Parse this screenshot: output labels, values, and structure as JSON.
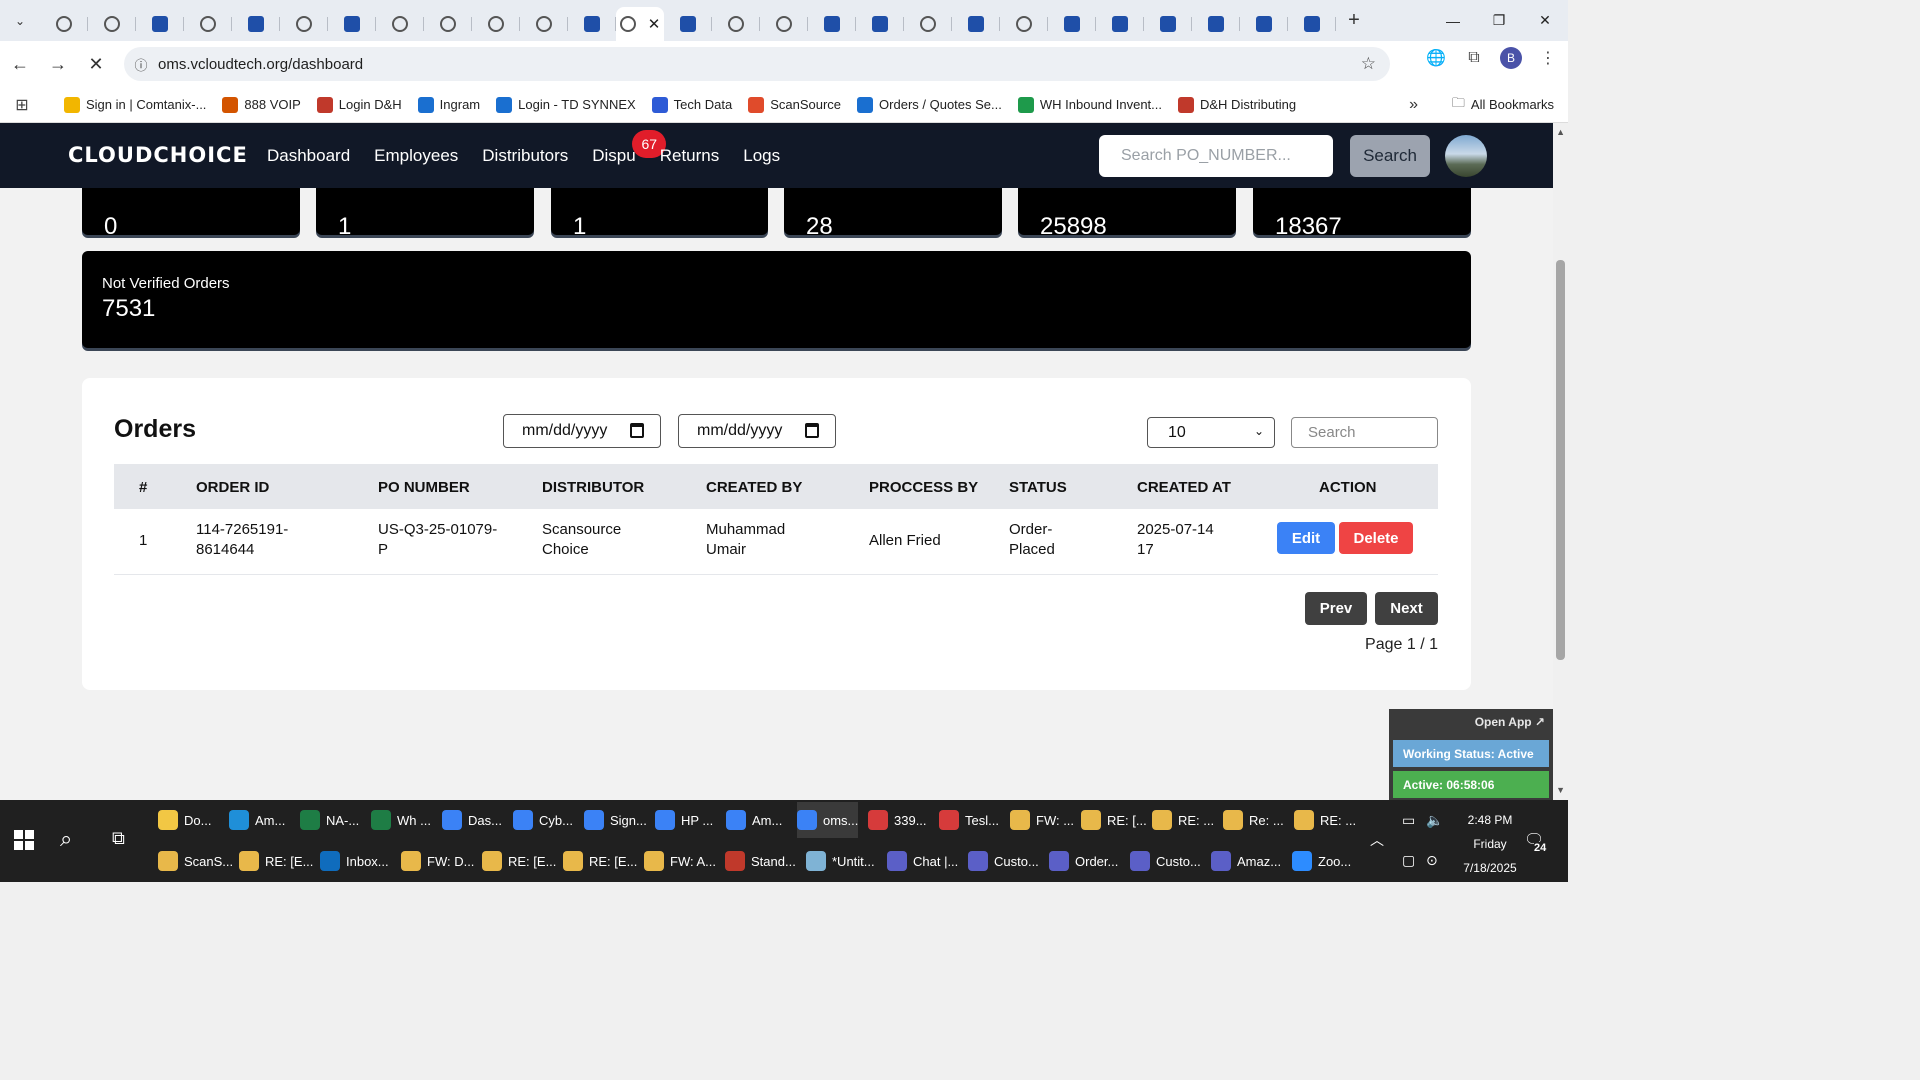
{
  "browser": {
    "url": "oms.vcloudtech.org/dashboard",
    "bookmarks": [
      {
        "label": "Sign in | Comtanix-...",
        "color": "#f2b600"
      },
      {
        "label": "888 VOIP",
        "color": "#d35400"
      },
      {
        "label": "Login D&H",
        "color": "#c0392b"
      },
      {
        "label": "Ingram",
        "color": "#1a6fd0"
      },
      {
        "label": "Login - TD SYNNEX",
        "color": "#1a6fd0"
      },
      {
        "label": "Tech Data",
        "color": "#2e5bd6"
      },
      {
        "label": "ScanSource",
        "color": "#e04b2b"
      },
      {
        "label": "Orders / Quotes Se...",
        "color": "#1a6fd0"
      },
      {
        "label": "WH Inbound Invent...",
        "color": "#1e9a4b"
      },
      {
        "label": "D&H Distributing",
        "color": "#c0392b"
      }
    ],
    "all_bookmarks": "All Bookmarks",
    "profile_initial": "B"
  },
  "navbar": {
    "logo": "CLOUDCHOICE",
    "links": [
      "Dashboard",
      "Employees",
      "Distributors",
      "Dispu",
      "Returns",
      "Logs"
    ],
    "badge": "67",
    "search_placeholder": "Search PO_NUMBER...",
    "search_button": "Search"
  },
  "stats": [
    "0",
    "1",
    "1",
    "28",
    "25898",
    "18367"
  ],
  "not_verified": {
    "label": "Not Verified Orders",
    "value": "7531"
  },
  "orders": {
    "title": "Orders",
    "date_from": "mm/dd/yyyy",
    "date_to": "mm/dd/yyyy",
    "page_size": "10",
    "search_placeholder": "Search",
    "columns": [
      "#",
      "ORDER ID",
      "PO NUMBER",
      "DISTRIBUTOR",
      "CREATED BY",
      "PROCCESS BY",
      "STATUS",
      "CREATED AT",
      "ACTION"
    ],
    "rows": [
      {
        "num": "1",
        "order_id": [
          "114-7265191-",
          "8614644"
        ],
        "po_number": [
          "US-Q3-25-01079-",
          "P"
        ],
        "distributor": [
          "Scansource",
          "Choice"
        ],
        "created_by": [
          "Muhammad",
          "Umair"
        ],
        "process_by": "Allen Fried",
        "status": [
          "Order-",
          "Placed"
        ],
        "created_at": [
          "2025-07-14",
          "17"
        ]
      }
    ],
    "edit_label": "Edit",
    "delete_label": "Delete",
    "prev_label": "Prev",
    "next_label": "Next",
    "page_info": "Page 1 / 1"
  },
  "widget": {
    "open_app": "Open App ↗",
    "working_status": "Working Status: Active",
    "active_time": "Active: 06:58:06"
  },
  "taskbar": {
    "row1": [
      {
        "label": "Do...",
        "color": "#f2c744"
      },
      {
        "label": "Am...",
        "color": "#1f8fd8"
      },
      {
        "label": "NA-...",
        "color": "#1e7d45"
      },
      {
        "label": "Wh ...",
        "color": "#1e7d45"
      },
      {
        "label": "Das...",
        "color": "#3b82f6"
      },
      {
        "label": "Cyb...",
        "color": "#3b82f6"
      },
      {
        "label": "Sign...",
        "color": "#3b82f6"
      },
      {
        "label": "HP ...",
        "color": "#3b82f6"
      },
      {
        "label": "Am...",
        "color": "#3b82f6"
      },
      {
        "label": "oms...",
        "color": "#3b82f6"
      },
      {
        "label": "339...",
        "color": "#d63b3b"
      },
      {
        "label": "Tesl...",
        "color": "#d63b3b"
      },
      {
        "label": "FW: ...",
        "color": "#e8b84a"
      },
      {
        "label": "RE: [...",
        "color": "#e8b84a"
      },
      {
        "label": "RE: ...",
        "color": "#e8b84a"
      },
      {
        "label": "Re: ...",
        "color": "#e8b84a"
      },
      {
        "label": "RE: ...",
        "color": "#e8b84a"
      }
    ],
    "row2": [
      {
        "label": "ScanS...",
        "color": "#e8b84a"
      },
      {
        "label": "RE: [E...",
        "color": "#e8b84a"
      },
      {
        "label": "Inbox...",
        "color": "#0f6cbd"
      },
      {
        "label": "FW: D...",
        "color": "#e8b84a"
      },
      {
        "label": "RE: [E...",
        "color": "#e8b84a"
      },
      {
        "label": "RE: [E...",
        "color": "#e8b84a"
      },
      {
        "label": "FW: A...",
        "color": "#e8b84a"
      },
      {
        "label": "Stand...",
        "color": "#c0392b"
      },
      {
        "label": "*Untit...",
        "color": "#7fb3d5"
      },
      {
        "label": "Chat |...",
        "color": "#5b5fc7"
      },
      {
        "label": "Custo...",
        "color": "#5b5fc7"
      },
      {
        "label": "Order...",
        "color": "#5b5fc7"
      },
      {
        "label": "Custo...",
        "color": "#5b5fc7"
      },
      {
        "label": "Amaz...",
        "color": "#5b5fc7"
      },
      {
        "label": "Zoo...",
        "color": "#2d8cff"
      }
    ],
    "time": "2:48 PM",
    "day": "Friday",
    "date": "7/18/2025",
    "notifications": "24"
  }
}
